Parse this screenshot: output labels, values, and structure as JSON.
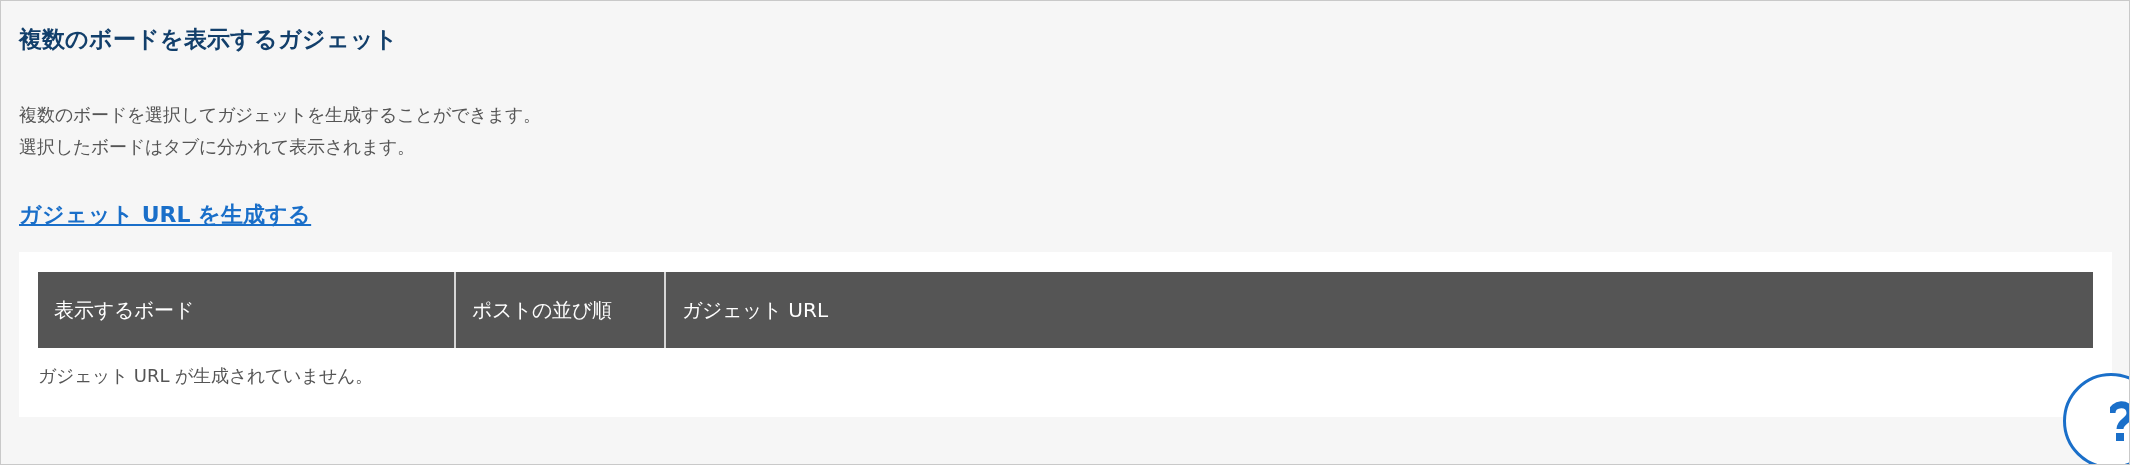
{
  "title": "複数のボードを表示するガジェット",
  "description": [
    "複数のボードを選択してガジェットを生成することができます。",
    "選択したボードはタブに分かれて表示されます。"
  ],
  "generate_link": "ガジェット URL を生成する",
  "table": {
    "columns": [
      "表示するボード",
      "ポストの並び順",
      "ガジェット URL"
    ],
    "empty_message": "ガジェット URL が生成されていません。"
  }
}
